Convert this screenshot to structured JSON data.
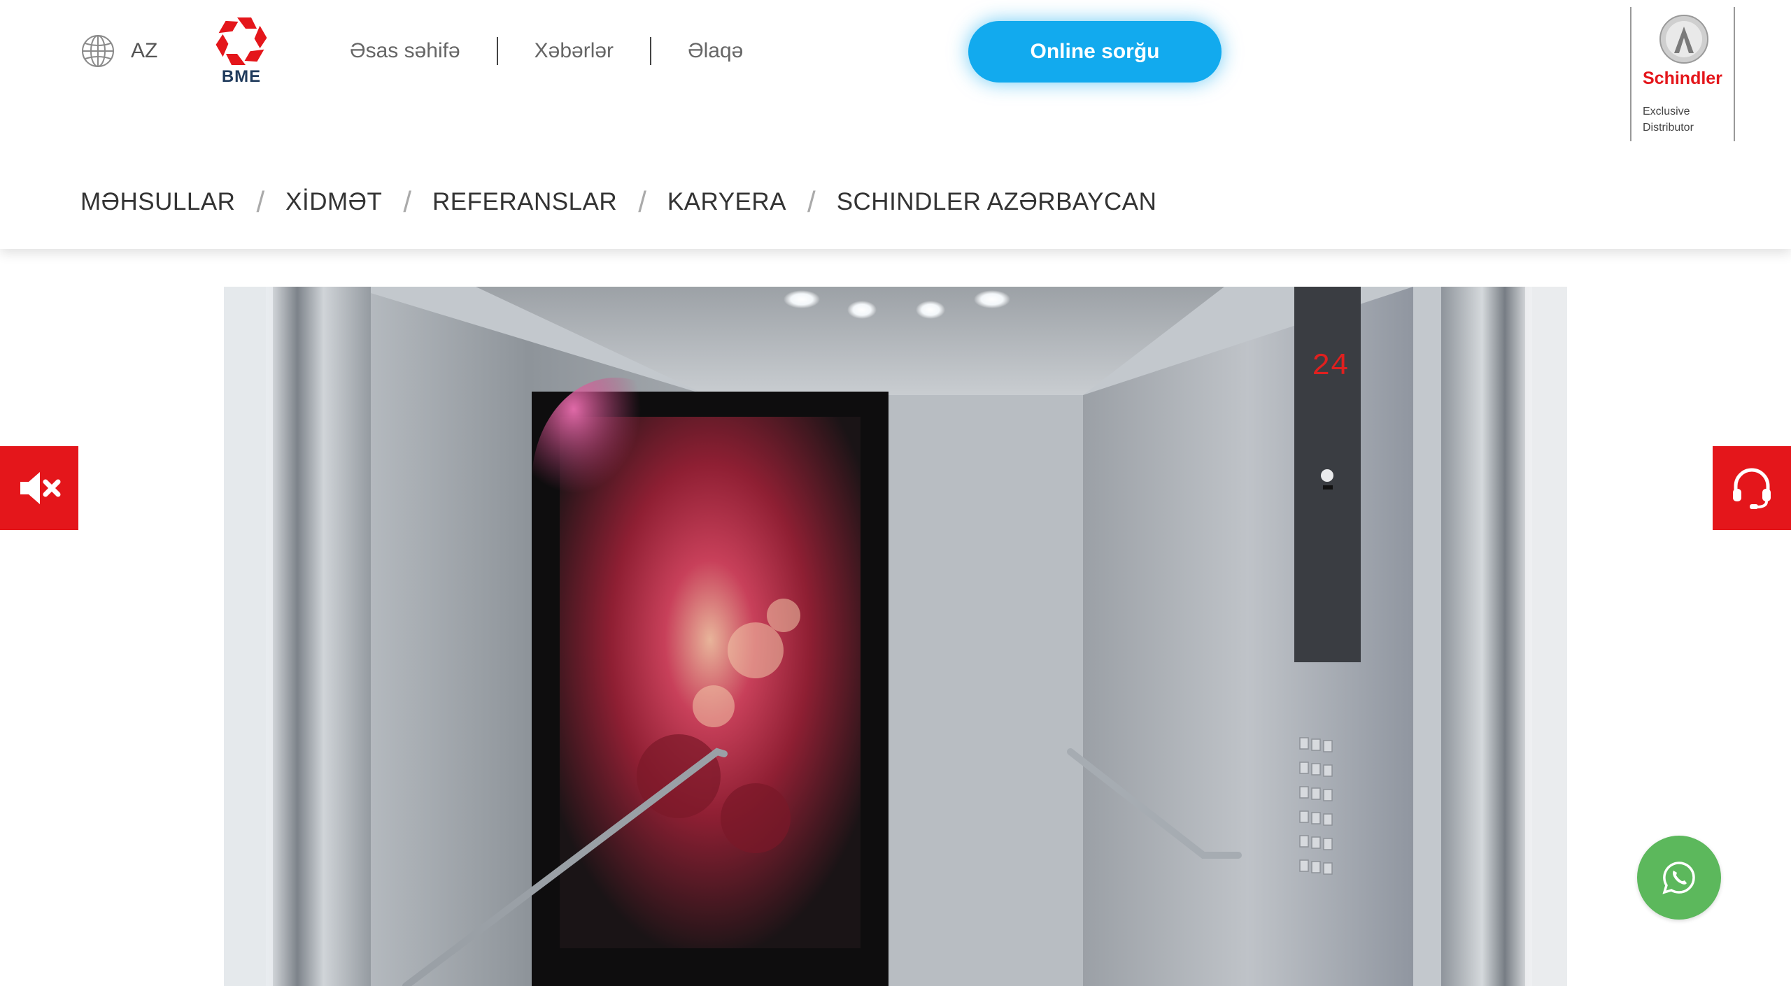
{
  "header": {
    "language": {
      "code": "AZ",
      "icon": "globe-icon"
    },
    "logo": {
      "text": "BME",
      "brand_color": "#e4161b"
    },
    "top_nav": [
      {
        "label": "Əsas səhifə"
      },
      {
        "label": "Xəbərlər"
      },
      {
        "label": "Əlaqə"
      }
    ],
    "cta_label": "Online sorğu",
    "cta_color": "#12aaee",
    "partner": {
      "name": "Schindler",
      "subtitle": "Exclusive Distributor",
      "color": "#e4161b"
    }
  },
  "main_nav": [
    {
      "label": "MƏHSULLAR"
    },
    {
      "label": "XİDMƏT"
    },
    {
      "label": "REFERANSLAR"
    },
    {
      "label": "KARYERA"
    },
    {
      "label": "SCHINDLER AZƏRBAYCAN"
    }
  ],
  "hero": {
    "scene": "elevator-cabin-video",
    "floor_display": "24",
    "video_muted": true
  },
  "floating": {
    "mute_icon": "volume-mute-icon",
    "support_icon": "headset-icon",
    "whatsapp_icon": "whatsapp-icon",
    "accent_red": "#e4161b",
    "whatsapp_green": "#5cb85c"
  }
}
